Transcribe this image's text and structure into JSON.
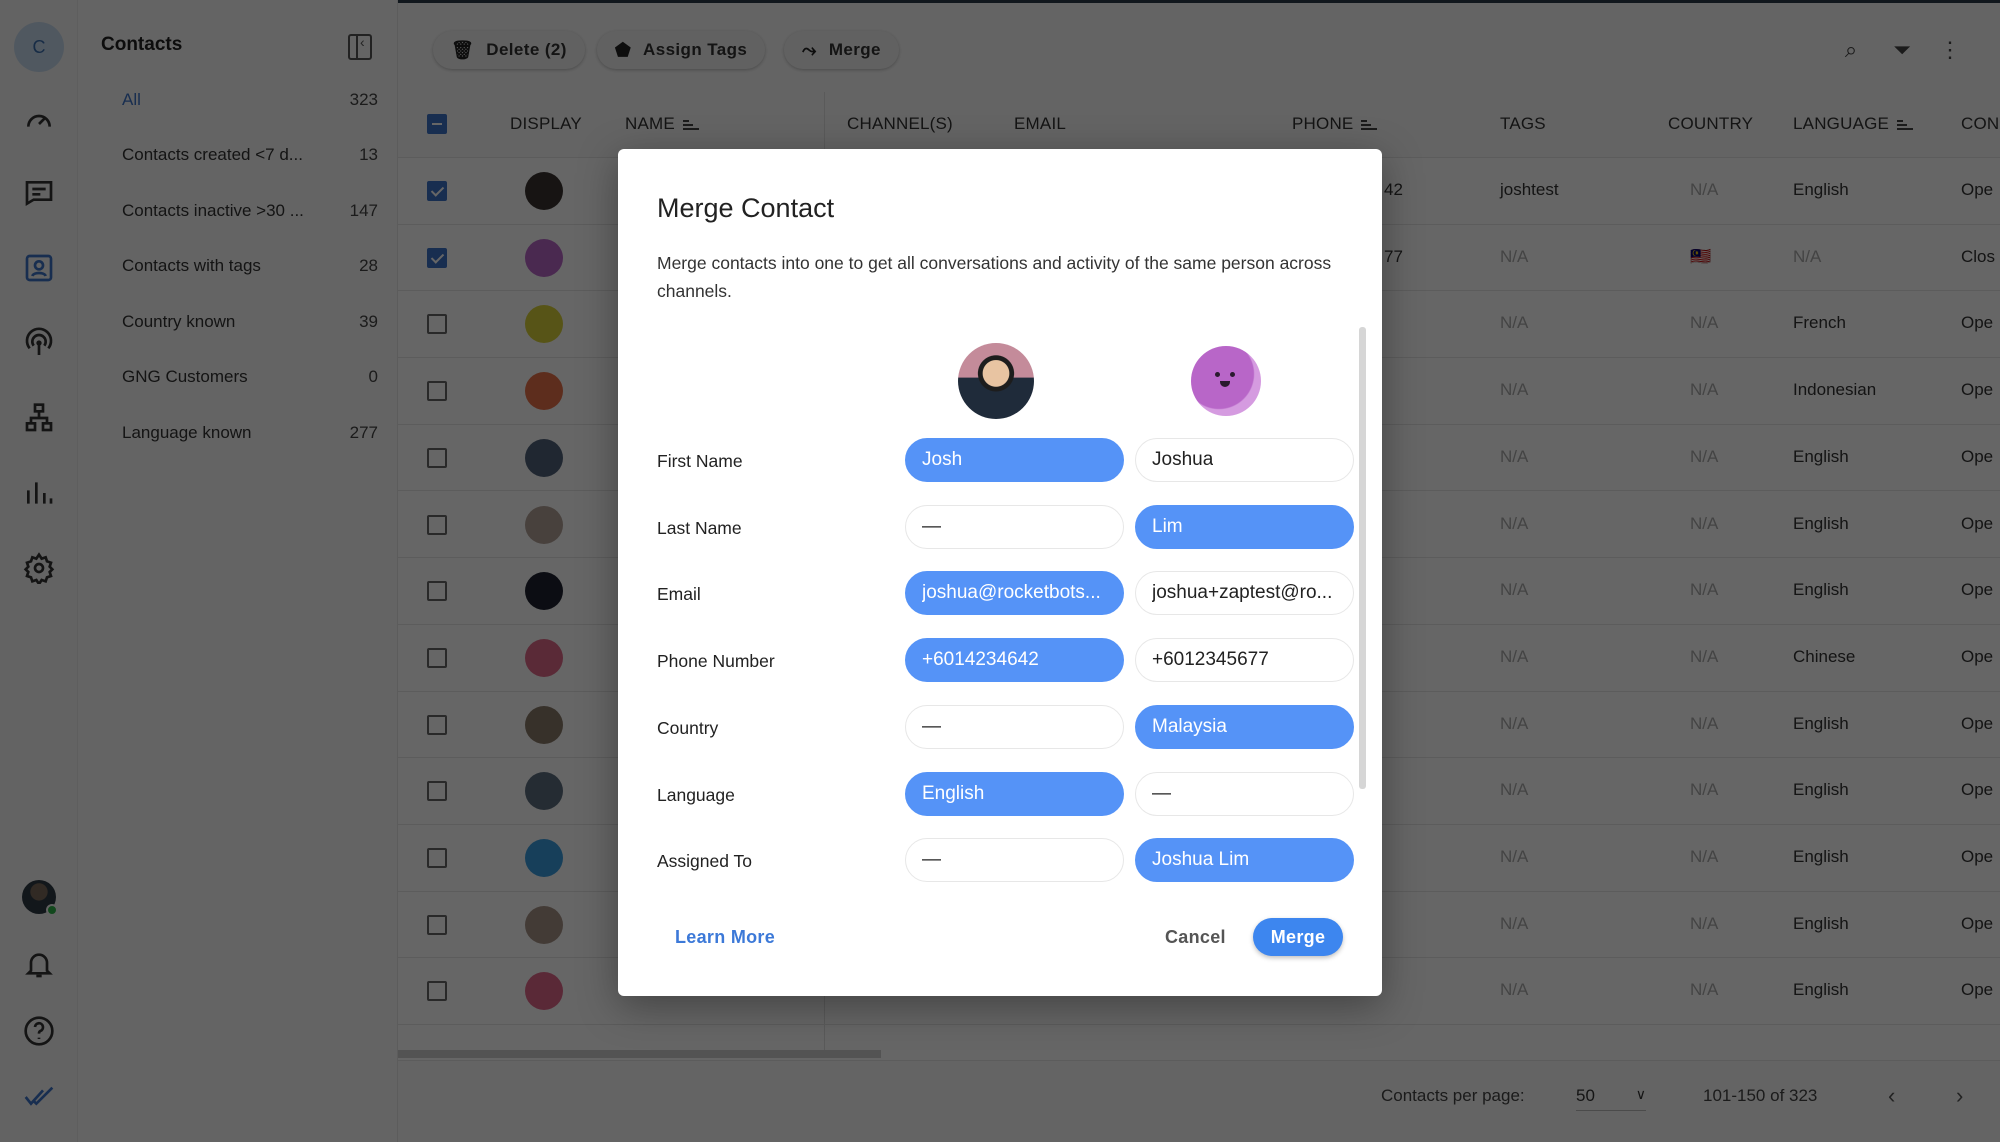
{
  "rail": {
    "org_initial": "C",
    "icons": [
      "dashboard-icon",
      "inbox-icon",
      "contacts-icon",
      "broadcast-icon",
      "workflows-icon",
      "reports-icon",
      "settings-icon"
    ],
    "active": "contacts-icon",
    "bottom_icons": [
      "user-avatar",
      "bell-icon",
      "help-icon",
      "logo-icon"
    ]
  },
  "sidebar": {
    "title": "Contacts",
    "segments": [
      {
        "label": "All",
        "count": "323",
        "active": true
      },
      {
        "label": "Contacts created <7 d...",
        "count": "13"
      },
      {
        "label": "Contacts inactive >30 ...",
        "count": "147"
      },
      {
        "label": "Contacts with tags",
        "count": "28"
      },
      {
        "label": "Country known",
        "count": "39"
      },
      {
        "label": "GNG Customers",
        "count": "0"
      },
      {
        "label": "Language known",
        "count": "277"
      }
    ]
  },
  "toolbar": {
    "delete_label": "Delete (2)",
    "assign_tags_label": "Assign Tags",
    "merge_label": "Merge"
  },
  "table": {
    "columns": [
      "DISPLAY",
      "NAME",
      "CHANNEL(S)",
      "EMAIL",
      "PHONE",
      "TAGS",
      "COUNTRY",
      "LANGUAGE",
      "CON"
    ],
    "rows": [
      {
        "checked": true,
        "avatar": "#3a3330",
        "phone_tail": "42",
        "tags": "joshtest",
        "country": "N/A",
        "language": "English",
        "status": "Ope"
      },
      {
        "checked": true,
        "avatar": "#b866c8",
        "phone_tail": "77",
        "tags": "N/A",
        "country": "🇲🇾",
        "language": "N/A",
        "status": "Clos"
      },
      {
        "checked": false,
        "avatar": "#d9d23a",
        "phone_tail": "",
        "tags": "N/A",
        "country": "N/A",
        "language": "French",
        "status": "Ope"
      },
      {
        "checked": false,
        "avatar": "#e8704a",
        "phone_tail": "",
        "tags": "N/A",
        "country": "N/A",
        "language": "Indonesian",
        "status": "Ope"
      },
      {
        "checked": false,
        "avatar": "#52637a",
        "phone_tail": "",
        "tags": "N/A",
        "country": "N/A",
        "language": "English",
        "status": "Ope"
      },
      {
        "checked": false,
        "avatar": "#b3a398",
        "phone_tail": "",
        "tags": "N/A",
        "country": "N/A",
        "language": "English",
        "status": "Ope"
      },
      {
        "checked": false,
        "avatar": "#1e2230",
        "phone_tail": "",
        "tags": "N/A",
        "country": "N/A",
        "language": "English",
        "status": "Ope"
      },
      {
        "checked": false,
        "avatar": "#e06a8a",
        "phone_tail": "",
        "tags": "N/A",
        "country": "N/A",
        "language": "Chinese",
        "status": "Ope"
      },
      {
        "checked": false,
        "avatar": "#8a7a6a",
        "phone_tail": "",
        "tags": "N/A",
        "country": "N/A",
        "language": "English",
        "status": "Ope"
      },
      {
        "checked": false,
        "avatar": "#5d6f80",
        "phone_tail": "",
        "tags": "N/A",
        "country": "N/A",
        "language": "English",
        "status": "Ope"
      },
      {
        "checked": false,
        "avatar": "#3a9ee0",
        "phone_tail": "",
        "tags": "N/A",
        "country": "N/A",
        "language": "English",
        "status": "Ope"
      },
      {
        "checked": false,
        "avatar": "#a89488",
        "phone_tail": "",
        "tags": "N/A",
        "country": "N/A",
        "language": "English",
        "status": "Ope"
      },
      {
        "checked": false,
        "avatar": "#e2668a",
        "phone_tail": "",
        "tags": "N/A",
        "country": "N/A",
        "language": "English",
        "status": "Ope"
      }
    ]
  },
  "footer": {
    "per_page_label": "Contacts per page:",
    "per_page_value": "50",
    "range": "101-150 of 323"
  },
  "modal": {
    "title": "Merge Contact",
    "description": "Merge contacts into one to get all conversations and activity of the same person across channels.",
    "fields": [
      {
        "label": "First Name",
        "left": "Josh",
        "right": "Joshua",
        "selected": "left"
      },
      {
        "label": "Last Name",
        "left": "—",
        "right": "Lim",
        "selected": "right"
      },
      {
        "label": "Email",
        "left": "joshua@rocketbots...",
        "right": "joshua+zaptest@ro...",
        "selected": "left"
      },
      {
        "label": "Phone Number",
        "left": "+6014234642",
        "right": "+6012345677",
        "selected": "left"
      },
      {
        "label": "Country",
        "left": "—",
        "right": "Malaysia",
        "selected": "right"
      },
      {
        "label": "Language",
        "left": "English",
        "right": "—",
        "selected": "left"
      },
      {
        "label": "Assigned To",
        "left": "—",
        "right": "Joshua Lim",
        "selected": "right"
      }
    ],
    "learn_more_label": "Learn More",
    "cancel_label": "Cancel",
    "merge_label": "Merge"
  },
  "colors": {
    "accent": "#3c73c8",
    "selected_pill": "#5593f7",
    "merge_button": "#3d86ef"
  }
}
